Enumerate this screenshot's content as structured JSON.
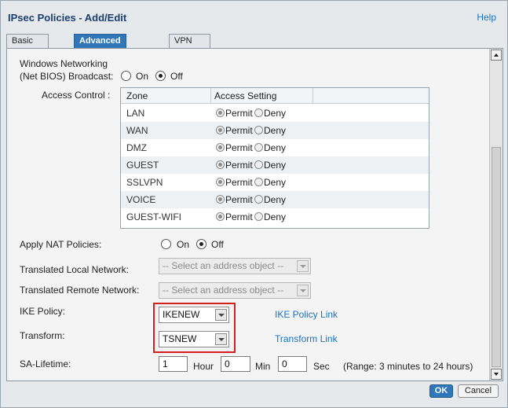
{
  "dialog": {
    "title": "IPsec Policies - Add/Edit",
    "help_label": "Help"
  },
  "tabs": [
    {
      "label": "Basic Settings",
      "active": false
    },
    {
      "label": "Advanced Settings",
      "active": true
    },
    {
      "label": "VPN Failover",
      "active": false
    }
  ],
  "windows_networking": {
    "label_line1": "Windows Networking",
    "label_line2": "(Net BIOS) Broadcast:",
    "on_label": "On",
    "off_label": "Off",
    "selected": "Off"
  },
  "access_control": {
    "label": "Access Control :",
    "columns": [
      "Zone",
      "Access Setting"
    ],
    "permit_label": "Permit",
    "deny_label": "Deny",
    "rows": [
      {
        "zone": "LAN",
        "access": "Permit"
      },
      {
        "zone": "WAN",
        "access": "Permit"
      },
      {
        "zone": "DMZ",
        "access": "Permit"
      },
      {
        "zone": "GUEST",
        "access": "Permit"
      },
      {
        "zone": "SSLVPN",
        "access": "Permit"
      },
      {
        "zone": "VOICE",
        "access": "Permit"
      },
      {
        "zone": "GUEST-WIFI",
        "access": "Permit"
      }
    ]
  },
  "nat": {
    "label": "Apply NAT Policies:",
    "on_label": "On",
    "off_label": "Off",
    "selected": "Off"
  },
  "translated_local": {
    "label": "Translated Local Network:",
    "value": "-- Select an address object --"
  },
  "translated_remote": {
    "label": "Translated Remote Network:",
    "value": "-- Select an address object --"
  },
  "ike_policy": {
    "label": "IKE Policy:",
    "value": "IKENEW",
    "link": "IKE Policy Link"
  },
  "transform": {
    "label": "Transform:",
    "value": "TSNEW",
    "link": "Transform Link"
  },
  "sa_lifetime": {
    "label": "SA-Lifetime:",
    "hour_value": "1",
    "hour_label": "Hour",
    "min_value": "0",
    "min_label": "Min",
    "sec_value": "0",
    "sec_label": "Sec",
    "range": "(Range: 3 minutes to 24 hours)"
  },
  "buttons": {
    "ok": "OK",
    "cancel": "Cancel"
  },
  "colors": {
    "accent": "#2f77b8",
    "link": "#1a73c2",
    "highlight": "#d21f1f"
  }
}
